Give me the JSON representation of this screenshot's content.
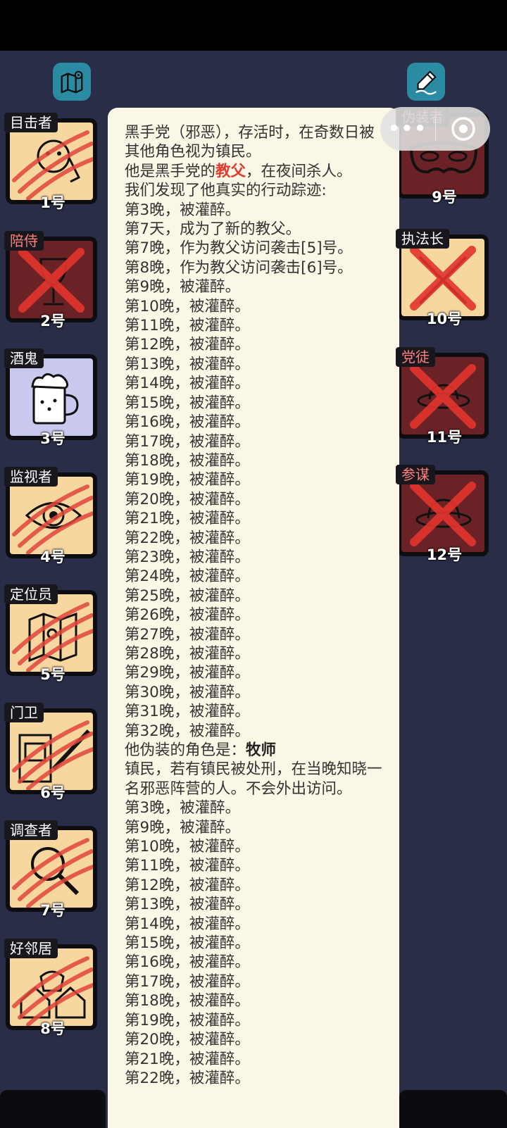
{
  "toolbar": {
    "map_icon": "map-pin-icon",
    "notes_icon": "pen-note-icon"
  },
  "left_cards": [
    {
      "role": "目击者",
      "number": "1号",
      "role_color": "white",
      "state": "scratched"
    },
    {
      "role": "陪侍",
      "number": "2号",
      "role_color": "red",
      "state": "crossed"
    },
    {
      "role": "酒鬼",
      "number": "3号",
      "role_color": "white",
      "state": "normal"
    },
    {
      "role": "监视者",
      "number": "4号",
      "role_color": "white",
      "state": "scratched"
    },
    {
      "role": "定位员",
      "number": "5号",
      "role_color": "white",
      "state": "scratched"
    },
    {
      "role": "门卫",
      "number": "6号",
      "role_color": "white",
      "state": "scratched"
    },
    {
      "role": "调查者",
      "number": "7号",
      "role_color": "white",
      "state": "scratched"
    },
    {
      "role": "好邻居",
      "number": "8号",
      "role_color": "white",
      "state": "scratched"
    }
  ],
  "right_cards": [
    {
      "role": "伪装者",
      "number": "9号",
      "role_color": "red",
      "state": "normal"
    },
    {
      "role": "执法长",
      "number": "10号",
      "role_color": "white",
      "state": "crossed"
    },
    {
      "role": "党徒",
      "number": "11号",
      "role_color": "red",
      "state": "crossed"
    },
    {
      "role": "参谋",
      "number": "12号",
      "role_color": "red",
      "state": "crossed"
    }
  ],
  "capsule": {
    "more_label": "•••",
    "close_icon": "target-circle-icon"
  },
  "popup": {
    "intro": "黑手党（邪恶），存活时，在奇数日被其他角色视为镇民。",
    "role_prefix": "他是黑手党的",
    "role_name": "教父",
    "role_suffix": "，在夜间杀人。",
    "found_line": "我们发现了他真实的行动踪迹:",
    "track_lines": [
      "第3晚，被灌醉。",
      "第7天，成为了新的教父。",
      "第7晚，作为教父访问袭击[5]号。",
      "第8晚，作为教父访问袭击[6]号。",
      "第9晚，被灌醉。",
      "第10晚，被灌醉。",
      "第11晚，被灌醉。",
      "第12晚，被灌醉。",
      "第13晚，被灌醉。",
      "第14晚，被灌醉。",
      "第15晚，被灌醉。",
      "第16晚，被灌醉。",
      "第17晚，被灌醉。",
      "第18晚，被灌醉。",
      "第19晚，被灌醉。",
      "第20晚，被灌醉。",
      "第21晚，被灌醉。",
      "第22晚，被灌醉。",
      "第23晚，被灌醉。",
      "第24晚，被灌醉。",
      "第25晚，被灌醉。",
      "第26晚，被灌醉。",
      "第27晚，被灌醉。",
      "第28晚，被灌醉。",
      "第29晚，被灌醉。",
      "第30晚，被灌醉。",
      "第31晚，被灌醉。",
      "第32晚，被灌醉。"
    ],
    "disguise_prefix": "他伪装的角色是：",
    "disguise_name": "牧师",
    "disguise_desc": "镇民，若有镇民被处刑，在当晚知晓一名邪恶阵营的人。不会外出访问。",
    "disguise_lines": [
      "第3晚，被灌醉。",
      "第9晚，被灌醉。",
      "第10晚，被灌醉。",
      "第11晚，被灌醉。",
      "第12晚，被灌醉。",
      "第13晚，被灌醉。",
      "第14晚，被灌醉。",
      "第15晚，被灌醉。",
      "第16晚，被灌醉。",
      "第17晚，被灌醉。",
      "第18晚，被灌醉。",
      "第19晚，被灌醉。",
      "第20晚，被灌醉。",
      "第21晚，被灌醉。",
      "第22晚，被灌醉。"
    ]
  }
}
